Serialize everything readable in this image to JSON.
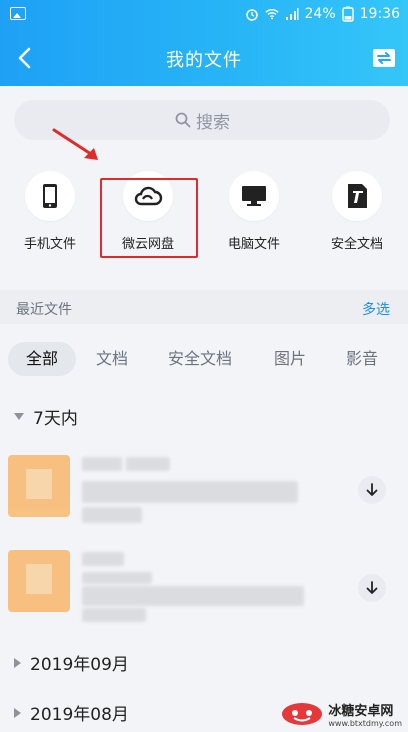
{
  "status": {
    "battery": "24%",
    "time": "19:36"
  },
  "header": {
    "title": "我的文件"
  },
  "search": {
    "placeholder": "搜索"
  },
  "quick": [
    {
      "label": "手机文件",
      "icon": "phone-icon"
    },
    {
      "label": "微云网盘",
      "icon": "cloud-icon"
    },
    {
      "label": "电脑文件",
      "icon": "monitor-icon"
    },
    {
      "label": "安全文档",
      "icon": "secure-doc-icon"
    }
  ],
  "recent": {
    "title": "最近文件",
    "multi_select": "多选"
  },
  "tabs": [
    "全部",
    "文档",
    "安全文档",
    "图片",
    "影音"
  ],
  "groups": [
    "7天内",
    "2019年09月",
    "2019年08月"
  ],
  "watermark": {
    "text": "冰糖安卓网",
    "url": "www.btxtdmy.com"
  },
  "colors": {
    "header_start": "#1ea1f5",
    "header_end": "#35c6f8",
    "accent": "#1d8fe0",
    "highlight": "#e02b2b"
  }
}
